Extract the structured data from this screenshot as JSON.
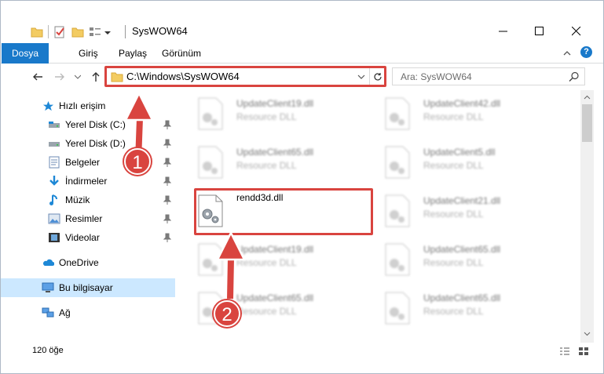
{
  "window": {
    "title": "SysWOW64"
  },
  "ribbon": {
    "tabs": [
      "Dosya",
      "Giriş",
      "Paylaş",
      "Görünüm"
    ],
    "help": "?"
  },
  "address": {
    "path": "C:\\Windows\\SysWOW64"
  },
  "search": {
    "placeholder": "Ara: SysWOW64"
  },
  "sidebar": {
    "items": [
      {
        "label": "Hızlı erişim",
        "icon": "star-icon"
      },
      {
        "label": "Yerel Disk (C:)",
        "icon": "drive-icon",
        "pinned": true
      },
      {
        "label": "Yerel Disk (D:)",
        "icon": "drive-icon",
        "pinned": true
      },
      {
        "label": "Belgeler",
        "icon": "documents-icon",
        "pinned": true
      },
      {
        "label": "İndirmeler",
        "icon": "downloads-icon",
        "pinned": true
      },
      {
        "label": "Müzik",
        "icon": "music-icon",
        "pinned": true
      },
      {
        "label": "Resimler",
        "icon": "pictures-icon",
        "pinned": true
      },
      {
        "label": "Videolar",
        "icon": "videos-icon",
        "pinned": true
      },
      {
        "label": "OneDrive",
        "icon": "onedrive-icon"
      },
      {
        "label": "Bu bilgisayar",
        "icon": "computer-icon",
        "selected": true
      },
      {
        "label": "Ağ",
        "icon": "network-icon"
      }
    ]
  },
  "files": [
    {
      "name": "UpdateClient19.dll",
      "type": "Resource DLL"
    },
    {
      "name": "UpdateClient42.dll",
      "type": "Resource DLL"
    },
    {
      "name": "UpdateClient65.dll",
      "type": "Resource DLL"
    },
    {
      "name": "UpdateClient5.dll",
      "type": "Resource DLL"
    },
    {
      "name": "rendd3d.dll",
      "type": ""
    },
    {
      "name": "UpdateClient21.dll",
      "type": "Resource DLL"
    },
    {
      "name": "UpdateClient19.dll",
      "type": "Resource DLL"
    },
    {
      "name": "UpdateClient65.dll",
      "type": "Resource DLL"
    },
    {
      "name": "UpdateClient65.dll",
      "type": "Resource DLL"
    },
    {
      "name": "UpdateClient65.dll",
      "type": "Resource DLL"
    }
  ],
  "status": {
    "item_count": "120 öğe"
  },
  "callouts": [
    "1",
    "2"
  ],
  "colors": {
    "accent": "#1979ca",
    "highlight": "#d9443f",
    "selected": "#cce8ff"
  }
}
